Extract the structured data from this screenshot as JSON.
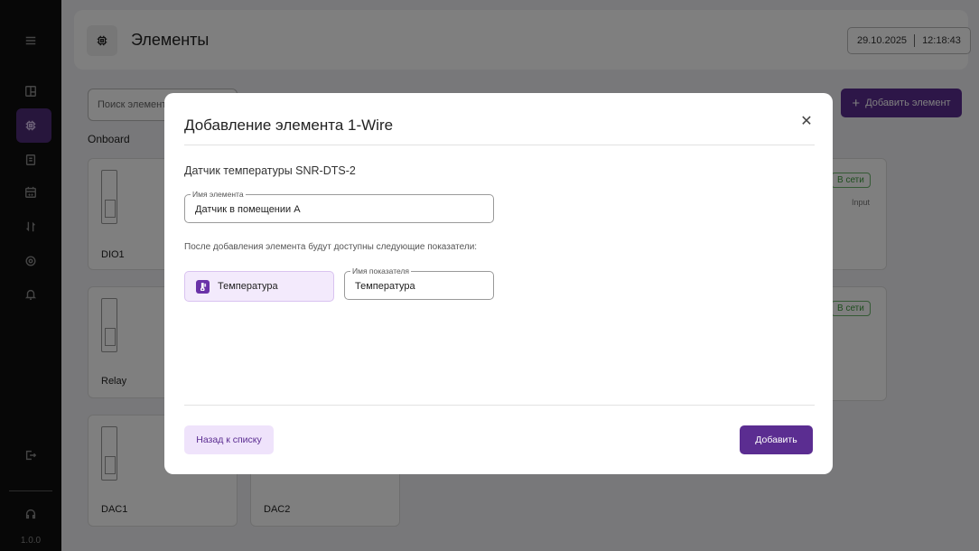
{
  "sidebar": {
    "items": [
      {
        "icon": "menu-icon"
      },
      {
        "icon": "dashboard-icon"
      },
      {
        "icon": "chip-icon",
        "active": true
      },
      {
        "icon": "document-icon"
      },
      {
        "icon": "calendar-code-icon"
      },
      {
        "icon": "transfer-icon"
      },
      {
        "icon": "settings-icon"
      },
      {
        "icon": "bell-icon"
      },
      {
        "icon": "logout-icon"
      },
      {
        "icon": "support-icon"
      }
    ],
    "version": "1.0.0"
  },
  "header": {
    "icon": "chip-icon",
    "title": "Элементы",
    "date": "29.10.2025",
    "time": "12:18:43"
  },
  "toolbar": {
    "search_placeholder": "Поиск элемента",
    "add_element_label": "Добавить элемент"
  },
  "group": {
    "label": "Onboard"
  },
  "cards": [
    {
      "label": "DIO1"
    },
    {
      "label": "Relay"
    },
    {
      "label": "DAC1"
    },
    {
      "label": "DAC2"
    }
  ],
  "background_badges": [
    {
      "text": "В сети",
      "subtext": "Input"
    },
    {
      "text": "В сети"
    }
  ],
  "modal": {
    "title": "Добавление элемента 1-Wire",
    "subtitle": "Датчик температуры SNR-DTS-2",
    "element_name": {
      "legend": "Имя элемента",
      "value": "Датчик в помещении А"
    },
    "hint": "После добавления элемента будут доступны следующие показатели:",
    "metrics": [
      {
        "icon": "thermometer-icon",
        "label": "Температура",
        "name_legend": "Имя показателя",
        "name_value": "Температура"
      }
    ],
    "back_label": "Назад к списку",
    "add_label": "Добавить"
  },
  "colors": {
    "accent": "#5b2d91",
    "accent_light": "#efe3fb",
    "sidebar_bg": "#0e0e0e",
    "status_green": "#3c9a3c"
  }
}
